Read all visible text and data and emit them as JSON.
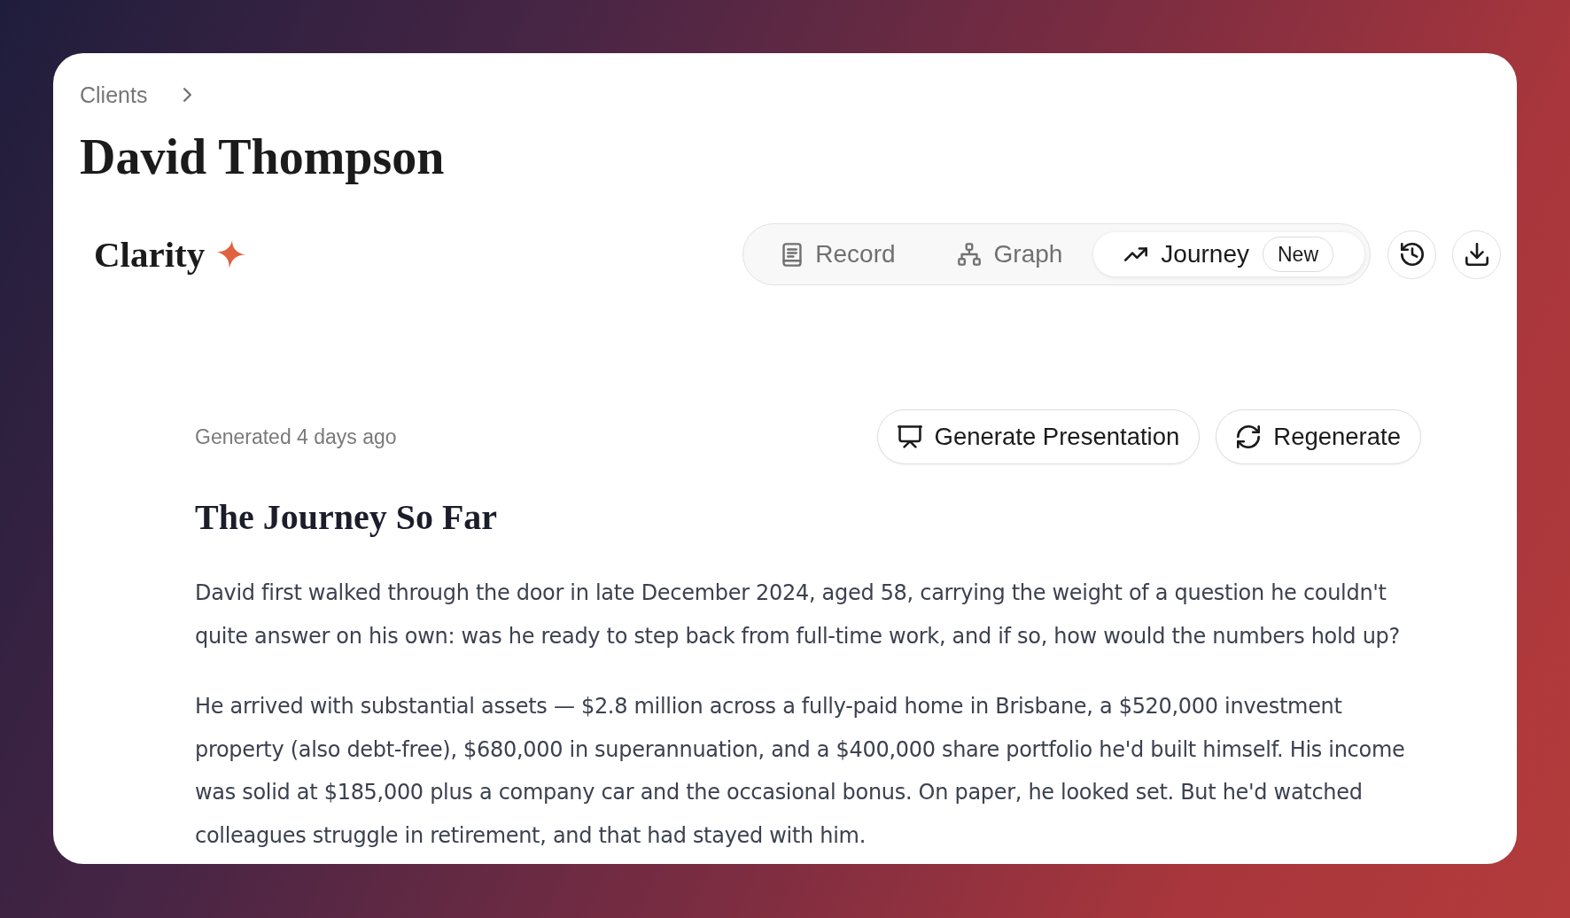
{
  "breadcrumb": [
    {
      "label": "Clients"
    }
  ],
  "title": "David Thompson",
  "brand": {
    "name": "Clarity"
  },
  "view_tabs": [
    {
      "label": "Record",
      "selected": false
    },
    {
      "label": "Graph",
      "selected": false
    },
    {
      "label": "Journey",
      "selected": true,
      "badge": "New"
    }
  ],
  "journey": {
    "generated": "Generated 4 days ago",
    "actions": [
      {
        "label": "Generate Presentation"
      },
      {
        "label": "Regenerate"
      }
    ],
    "heading": "The Journey So Far",
    "paragraphs": [
      "David first walked through the door in late December 2024, aged 58, carrying the weight of a question he couldn't quite answer on his own: was he ready to step back from full-time work, and if so, how would the numbers hold up?",
      "He arrived with substantial assets — $2.8 million across a fully-paid home in Brisbane, a $520,000 investment property (also debt-free), $680,000 in superannuation, and a $400,000 share portfolio he'd built himself. His income was solid at $185,000 plus a company car and the occasional bonus. On paper, he looked set. But he'd watched colleagues struggle in retirement, and that had stayed with him."
    ]
  }
}
